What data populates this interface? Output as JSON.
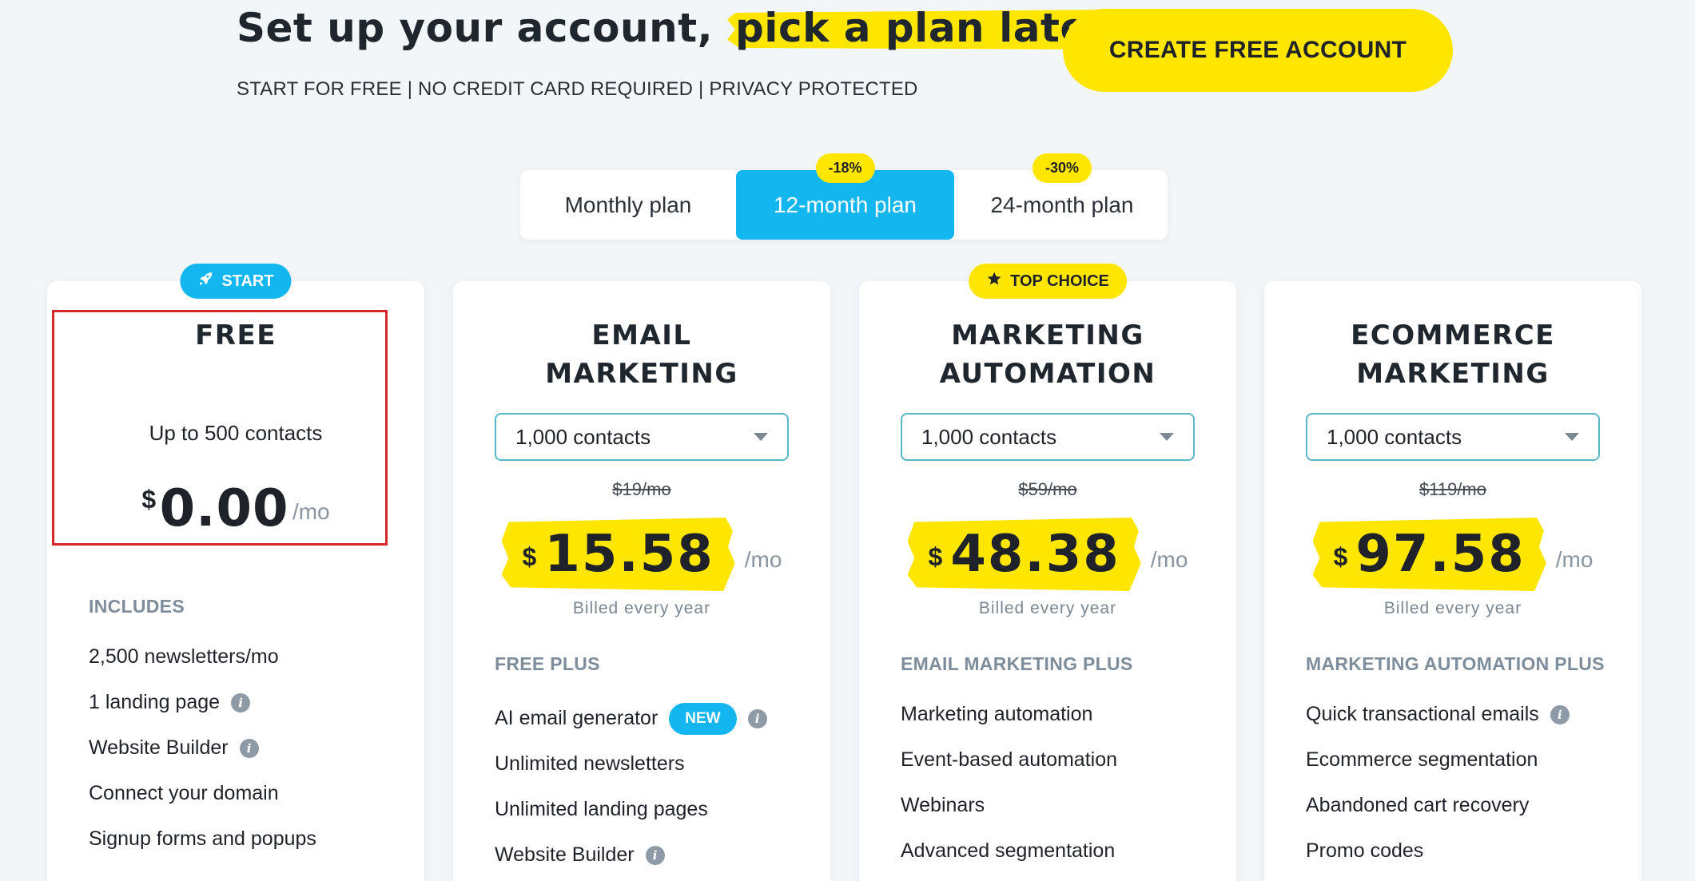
{
  "hero": {
    "title_main": "Set up your account,",
    "title_highlight": "pick a plan later",
    "subtitle": "START FOR FREE | NO CREDIT CARD REQUIRED | PRIVACY PROTECTED",
    "cta_label": "CREATE FREE ACCOUNT"
  },
  "plan_toggle": {
    "options": [
      {
        "label": "Monthly plan",
        "badge": ""
      },
      {
        "label": "12-month plan",
        "badge": "-18%"
      },
      {
        "label": "24-month plan",
        "badge": "-30%"
      }
    ],
    "active_index": 1
  },
  "cards": {
    "free": {
      "ribbon": "START",
      "name_line1": "FREE",
      "contacts": "Up to 500 contacts",
      "currency": "$",
      "price": "0.00",
      "period": "/mo",
      "section_label": "INCLUDES",
      "features": [
        {
          "label": "2,500 newsletters/mo",
          "info": false
        },
        {
          "label": "1 landing page",
          "info": true
        },
        {
          "label": "Website Builder",
          "info": true
        },
        {
          "label": "Connect your domain",
          "info": false
        },
        {
          "label": "Signup forms and popups",
          "info": false
        }
      ]
    },
    "email": {
      "name_line1": "EMAIL",
      "name_line2": "MARKETING",
      "contacts_select": "1,000 contacts",
      "old_price": "$19/mo",
      "currency": "$",
      "price": "15.58",
      "period": "/mo",
      "billed": "Billed every year",
      "section_label": "FREE PLUS",
      "features": [
        {
          "label": "AI email generator",
          "new_badge": "NEW",
          "info": true
        },
        {
          "label": "Unlimited newsletters",
          "info": false
        },
        {
          "label": "Unlimited landing pages",
          "info": false
        },
        {
          "label": "Website Builder",
          "info": true
        }
      ]
    },
    "automation": {
      "ribbon": "TOP CHOICE",
      "name_line1": "MARKETING",
      "name_line2": "AUTOMATION",
      "contacts_select": "1,000 contacts",
      "old_price": "$59/mo",
      "currency": "$",
      "price": "48.38",
      "period": "/mo",
      "billed": "Billed every year",
      "section_label": "EMAIL MARKETING PLUS",
      "features": [
        {
          "label": "Marketing automation",
          "info": false
        },
        {
          "label": "Event-based automation",
          "info": false
        },
        {
          "label": "Webinars",
          "info": false
        },
        {
          "label": "Advanced segmentation",
          "info": false
        }
      ]
    },
    "ecommerce": {
      "name_line1": "ECOMMERCE",
      "name_line2": "MARKETING",
      "contacts_select": "1,000 contacts",
      "old_price": "$119/mo",
      "currency": "$",
      "price": "97.58",
      "period": "/mo",
      "billed": "Billed every year",
      "section_label": "MARKETING AUTOMATION PLUS",
      "features": [
        {
          "label": "Quick transactional emails",
          "info": true
        },
        {
          "label": "Ecommerce segmentation",
          "info": false
        },
        {
          "label": "Abandoned cart recovery",
          "info": false
        },
        {
          "label": "Promo codes",
          "info": false
        }
      ]
    }
  },
  "colors": {
    "accent_yellow": "#ffe600",
    "accent_blue": "#14b6ef",
    "highlight_box": "#d6262c",
    "background": "#f3f6f8"
  },
  "icons": {
    "start_ribbon": "rocket-icon",
    "top_choice_ribbon": "star-icon",
    "feature_info": "info-icon",
    "select_caret": "caret-down-icon"
  }
}
